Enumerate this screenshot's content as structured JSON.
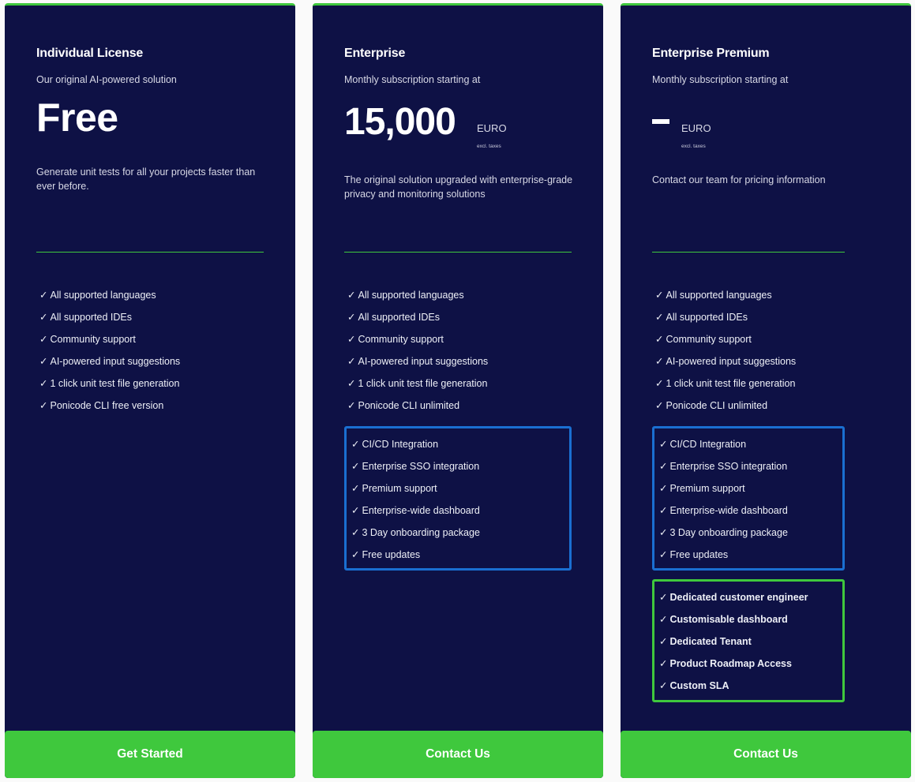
{
  "colors": {
    "card_background": "#0e1145",
    "accent_green": "#3fc83d",
    "enterprise_box_blue": "#1a6fd1",
    "page_background": "#fafafa"
  },
  "check_icon": "✓",
  "plans": [
    {
      "title": "Individual License",
      "subtitle": "Our original AI-powered solution",
      "price": "Free",
      "description": "Generate unit tests for all your projects faster than ever before.",
      "features": [
        "All supported languages",
        "All supported IDEs",
        "Community support",
        "AI-powered input suggestions",
        "1 click unit test file generation",
        "Ponicode CLI free version"
      ],
      "cta_label": "Get Started"
    },
    {
      "title": "Enterprise",
      "subtitle": "Monthly subscription starting at",
      "price": "15,000",
      "currency": "EURO",
      "taxes_note": "excl. taxes",
      "description": "The original solution upgraded with enterprise-grade privacy and monitoring solutions",
      "features": [
        "All supported languages",
        "All supported IDEs",
        "Community support",
        "AI-powered input suggestions",
        "1 click unit test file generation",
        "Ponicode CLI unlimited"
      ],
      "enterprise_features": [
        "CI/CD Integration",
        "Enterprise SSO integration",
        "Premium support",
        "Enterprise-wide dashboard",
        "3 Day onboarding package",
        "Free updates"
      ],
      "cta_label": "Contact Us"
    },
    {
      "title": "Enterprise Premium",
      "subtitle": "Monthly subscription starting at",
      "price": "–",
      "currency": "EURO",
      "taxes_note": "excl. taxes",
      "description": "Contact our team for pricing information",
      "features": [
        "All supported languages",
        "All supported IDEs",
        "Community support",
        "AI-powered input suggestions",
        "1 click unit test file generation",
        "Ponicode CLI unlimited"
      ],
      "enterprise_features": [
        "CI/CD Integration",
        "Enterprise SSO integration",
        "Premium support",
        "Enterprise-wide dashboard",
        "3 Day onboarding package",
        "Free updates"
      ],
      "premium_features": [
        "Dedicated customer engineer",
        "Customisable dashboard",
        "Dedicated Tenant",
        "Product Roadmap Access",
        "Custom SLA"
      ],
      "cta_label": "Contact Us"
    }
  ]
}
